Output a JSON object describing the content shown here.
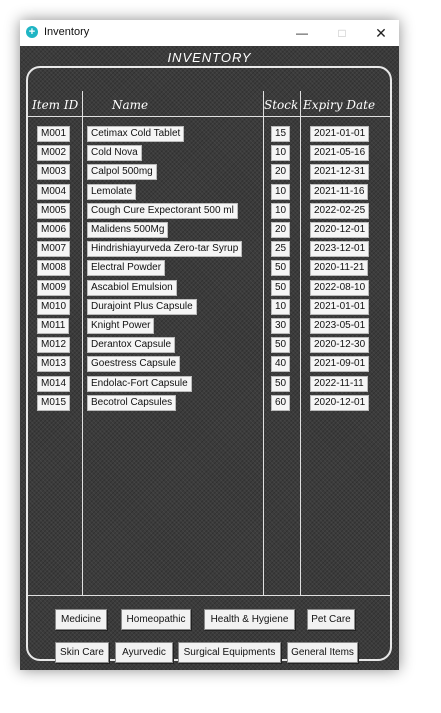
{
  "window": {
    "title": "Inventory",
    "min": "—",
    "max": "□",
    "close": "✕"
  },
  "heading": "INVENTORY",
  "columns": {
    "id": "Item ID",
    "name": "Name",
    "stock": "Stock",
    "expiry": "Expiry Date"
  },
  "rows": [
    {
      "id": "M001",
      "name": "Cetimax Cold Tablet",
      "stock": "15",
      "expiry": "2021-01-01"
    },
    {
      "id": "M002",
      "name": "Cold Nova",
      "stock": "10",
      "expiry": "2021-05-16"
    },
    {
      "id": "M003",
      "name": "Calpol 500mg",
      "stock": "20",
      "expiry": "2021-12-31"
    },
    {
      "id": "M004",
      "name": "Lemolate",
      "stock": "10",
      "expiry": "2021-11-16"
    },
    {
      "id": "M005",
      "name": "Cough Cure Expectorant 500 ml",
      "stock": "10",
      "expiry": "2022-02-25"
    },
    {
      "id": "M006",
      "name": "Malidens 500Mg",
      "stock": "20",
      "expiry": "2020-12-01"
    },
    {
      "id": "M007",
      "name": "Hindrishiayurveda Zero-tar Syrup",
      "stock": "25",
      "expiry": "2023-12-01"
    },
    {
      "id": "M008",
      "name": "Electral Powder",
      "stock": "50",
      "expiry": "2020-11-21"
    },
    {
      "id": "M009",
      "name": "Ascabiol Emulsion",
      "stock": "50",
      "expiry": "2022-08-10"
    },
    {
      "id": "M010",
      "name": "Durajoint Plus Capsule",
      "stock": "10",
      "expiry": "2021-01-01"
    },
    {
      "id": "M011",
      "name": "Knight Power",
      "stock": "30",
      "expiry": "2023-05-01"
    },
    {
      "id": "M012",
      "name": "Derantox Capsule",
      "stock": "50",
      "expiry": "2020-12-30"
    },
    {
      "id": "M013",
      "name": "Goestress Capsule",
      "stock": "40",
      "expiry": "2021-09-01"
    },
    {
      "id": "M014",
      "name": "Endolac-Fort Capsule",
      "stock": "50",
      "expiry": "2022-11-11"
    },
    {
      "id": "M015",
      "name": "Becotrol Capsules",
      "stock": "60",
      "expiry": "2020-12-01"
    }
  ],
  "categories_row1": [
    "Medicine",
    "Homeopathic",
    "Health & Hygiene",
    "Pet Care"
  ],
  "categories_row2": [
    "Skin Care",
    "Ayurvedic",
    "Surgical Equipments",
    "General Items"
  ]
}
